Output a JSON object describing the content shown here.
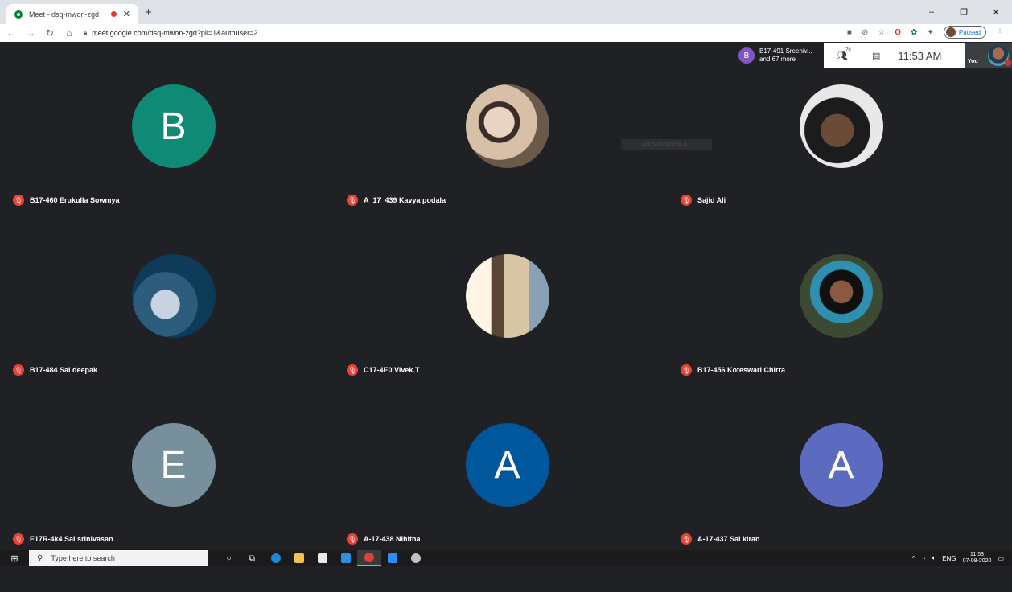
{
  "browser": {
    "tab_title": "Meet - dsq-mwon-zgd",
    "tab_close": "✕",
    "new_tab": "+",
    "url": "meet.google.com/dsq-mwon-zgd?pli=1&authuser=2",
    "paused_label": "Paused",
    "window_controls": [
      "–",
      "❐",
      "✕"
    ]
  },
  "meet": {
    "people_chip": {
      "avatar_letter": "B",
      "line1": "B17-491 Sreeniv...",
      "line2": "and 67 more"
    },
    "people_count": "78",
    "clock": "11:53 AM",
    "you_label": "You",
    "ghost_tooltip": "Ask someone to p...",
    "participants": [
      {
        "name": "B17-460 Erukulla Sowmya",
        "letter": "B",
        "color": "#0f8a74",
        "photo": null
      },
      {
        "name": "A_17_439 Kavya podala",
        "letter": "",
        "color": "#7a6a5a",
        "photo": "couple"
      },
      {
        "name": "Sajid Ali",
        "letter": "",
        "color": "#8c8c8c",
        "photo": "face"
      },
      {
        "name": "B17-484 Sai deepak",
        "letter": "",
        "color": "#2f5f7a",
        "photo": "dj"
      },
      {
        "name": "C17-4E0 Vivek.T",
        "letter": "",
        "color": "#c9b79a",
        "photo": "wall"
      },
      {
        "name": "B17-456 Koteswari Chirra",
        "letter": "",
        "color": "#2b3b2d",
        "photo": "girl"
      },
      {
        "name": "E17R-4k4 Sai srinivasan",
        "letter": "E",
        "color": "#78909c",
        "photo": null
      },
      {
        "name": "A-17-438 Nihitha",
        "letter": "A",
        "color": "#01579b",
        "photo": null
      },
      {
        "name": "A-17-437 Sai kiran",
        "letter": "A",
        "color": "#5c6bc0",
        "photo": null
      }
    ]
  },
  "taskbar": {
    "search_placeholder": "Type here to search",
    "tray_lang": "ENG",
    "tray_time": "11:53",
    "tray_date": "07-08-2020"
  }
}
